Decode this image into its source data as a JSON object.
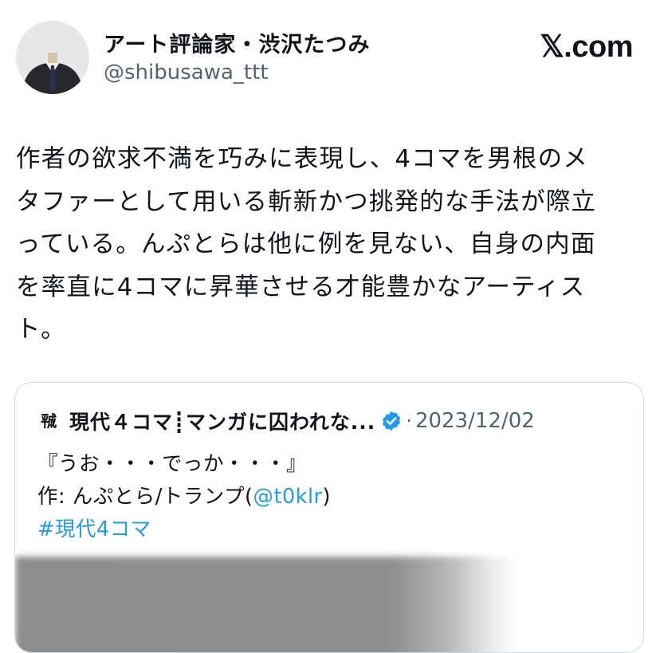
{
  "author": {
    "display_name": "アート評論家・渋沢たつみ",
    "handle": "@shibusawa_ttt"
  },
  "brand": "𝕏.com",
  "post": {
    "text_lines": [
      "作者の欲求不満を巧みに表現し、4コマを男根のメ",
      "タファーとして用いる斬新かつ挑発的な手法が際立",
      "っている。んぷとらは他に例を見ない、自身の内面",
      "を率直に4コマに昇華させる才能豊かなアーティス",
      "ト。"
    ]
  },
  "quote": {
    "avatar_glyph": "㍻",
    "name": "現代４コマ┋マンガに囚われな...",
    "separator": "·",
    "date": "2023/12/02",
    "line1": "『うお・・・でっか・・・』",
    "credit_prefix": "作: んぷとら/トランプ(",
    "credit_link": "@t0klr",
    "credit_suffix": ")",
    "hashtag": "#現代4コマ"
  },
  "colors": {
    "text": "#0f1419",
    "secondary": "#536471",
    "link": "#1d9bf0",
    "border": "#cfd9de"
  },
  "icons": {
    "verified": "verified-badge-icon"
  }
}
